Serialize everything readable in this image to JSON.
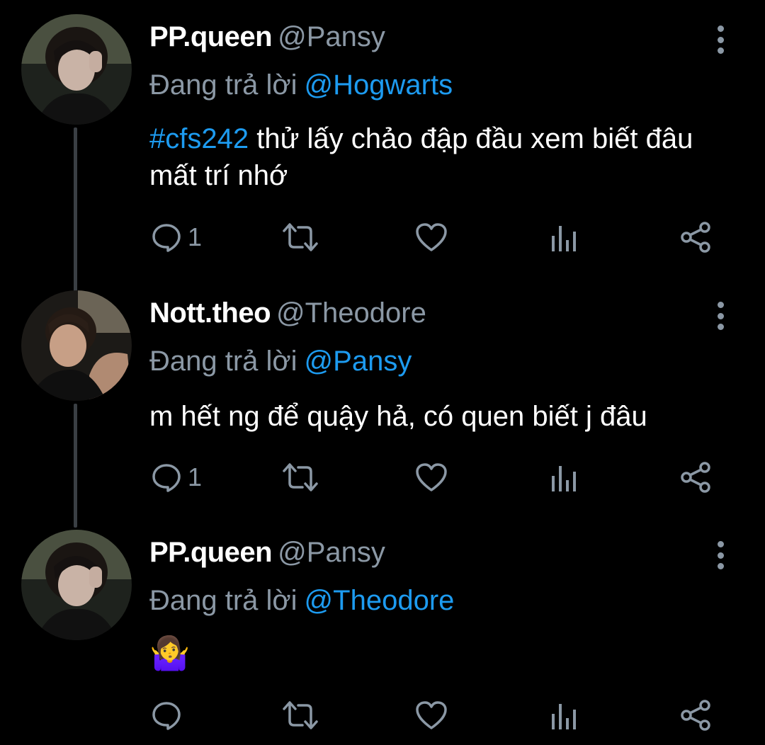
{
  "colors": {
    "background": "#000000",
    "text": "#ffffff",
    "muted": "#8b98a5",
    "accent": "#1d9bf0",
    "thread_line": "#3a3f44"
  },
  "tweets": [
    {
      "display_name": "PP.queen",
      "handle": "@Pansy",
      "reply_prefix": "Đang trả lời",
      "reply_to": "@Hogwarts",
      "hashtag": "#cfs242",
      "text": "thử lấy chảo đập đầu xem biết đâu mất trí nhớ",
      "actions": {
        "reply_icon": "comment-icon",
        "reply_count": "1",
        "retweet_icon": "retweet-icon",
        "like_icon": "heart-icon",
        "analytics_icon": "analytics-icon",
        "share_icon": "share-icon"
      }
    },
    {
      "display_name": "Nott.theo",
      "handle": "@Theodore",
      "reply_prefix": "Đang trả lời",
      "reply_to": "@Pansy",
      "text": "m hết ng để quậy hả, có quen biết j đâu",
      "actions": {
        "reply_icon": "comment-icon",
        "reply_count": "1",
        "retweet_icon": "retweet-icon",
        "like_icon": "heart-icon",
        "analytics_icon": "analytics-icon",
        "share_icon": "share-icon"
      }
    },
    {
      "display_name": "PP.queen",
      "handle": "@Pansy",
      "reply_prefix": "Đang trả lời",
      "reply_to": "@Theodore",
      "emoji": "🤷‍♀️",
      "actions": {
        "reply_icon": "comment-icon",
        "reply_count": "",
        "retweet_icon": "retweet-icon",
        "like_icon": "heart-icon",
        "analytics_icon": "analytics-icon",
        "share_icon": "share-icon"
      }
    }
  ]
}
